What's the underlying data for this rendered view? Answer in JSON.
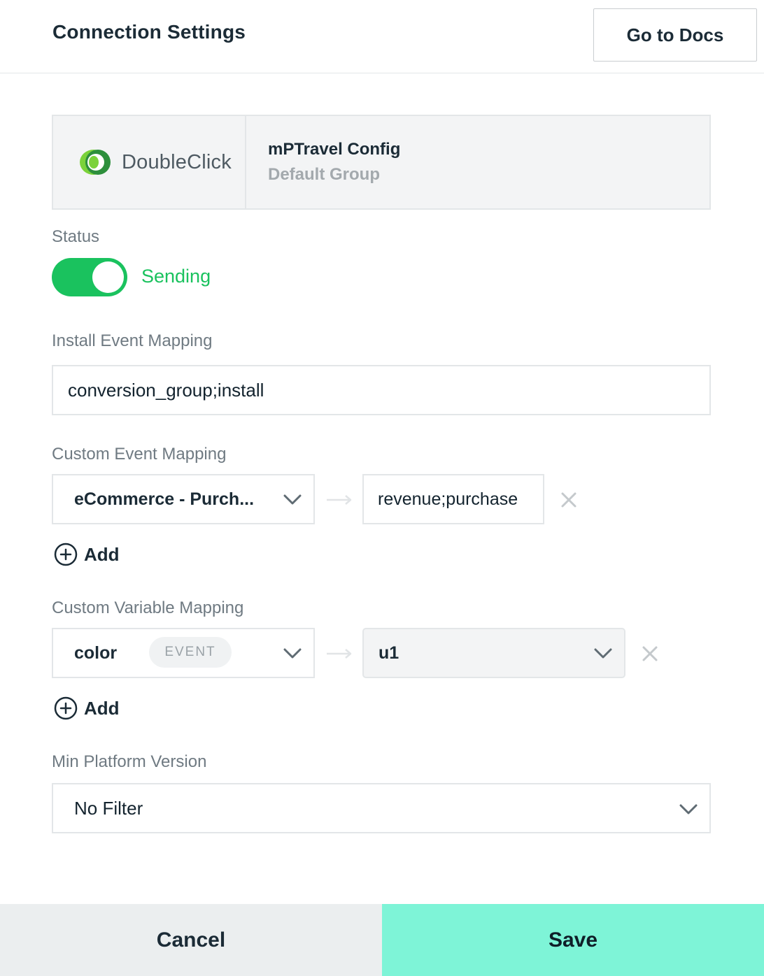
{
  "header": {
    "title": "Connection Settings",
    "docs_label": "Go to Docs"
  },
  "connection": {
    "partner_name": "DoubleClick",
    "partner_icon": "doubleclick-logo-icon",
    "config_name": "mPTravel Config",
    "group_name": "Default Group"
  },
  "status": {
    "label": "Status",
    "enabled": true,
    "state_text": "Sending",
    "color": "#1ac25e"
  },
  "install_mapping": {
    "label": "Install Event Mapping",
    "value": "conversion_group;install"
  },
  "custom_event_mapping": {
    "label": "Custom Event Mapping",
    "event_selected": "eCommerce - Purch...",
    "mapped_value": "revenue;purchase",
    "add_label": "Add"
  },
  "custom_variable_mapping": {
    "label": "Custom Variable Mapping",
    "variable_selected": "color",
    "variable_badge": "EVENT",
    "target_selected": "u1",
    "add_label": "Add"
  },
  "min_platform": {
    "label": "Min Platform Version",
    "selected": "No Filter"
  },
  "footer": {
    "cancel_label": "Cancel",
    "save_label": "Save",
    "save_color": "#7ef4d7"
  }
}
